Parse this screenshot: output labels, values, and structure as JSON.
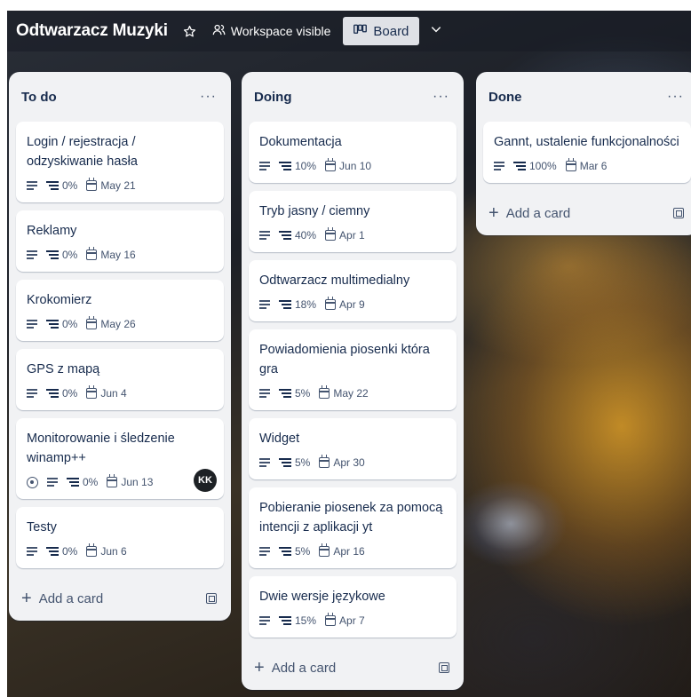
{
  "board": {
    "title": "Odtwarzacz Muzyki",
    "visibility_label": "Workspace visible",
    "view_label": "Board"
  },
  "lists": [
    {
      "title": "To do",
      "menu": "···",
      "add_label": "Add a card",
      "cards": [
        {
          "title": "Login / rejestracja / odzyskiwanie hasła",
          "progress": "0%",
          "date": "May 21"
        },
        {
          "title": "Reklamy",
          "progress": "0%",
          "date": "May 16"
        },
        {
          "title": "Krokomierz",
          "progress": "0%",
          "date": "May 26"
        },
        {
          "title": "GPS z mapą",
          "progress": "0%",
          "date": "Jun 4"
        },
        {
          "title": "Monitorowanie i śledzenie winamp++",
          "progress": "0%",
          "date": "Jun 13",
          "watched": true,
          "member": "KK"
        },
        {
          "title": "Testy",
          "progress": "0%",
          "date": "Jun 6"
        }
      ]
    },
    {
      "title": "Doing",
      "menu": "···",
      "add_label": "Add a card",
      "cards": [
        {
          "title": "Dokumentacja",
          "progress": "10%",
          "date": "Jun 10"
        },
        {
          "title": "Tryb jasny / ciemny",
          "progress": "40%",
          "date": "Apr 1"
        },
        {
          "title": "Odtwarzacz multimedialny",
          "progress": "18%",
          "date": "Apr 9"
        },
        {
          "title": "Powiadomienia piosenki która gra",
          "progress": "5%",
          "date": "May 22"
        },
        {
          "title": "Widget",
          "progress": "5%",
          "date": "Apr 30"
        },
        {
          "title": "Pobieranie piosenek za pomocą intencji z aplikacji yt",
          "progress": "5%",
          "date": "Apr 16"
        },
        {
          "title": "Dwie wersje językowe",
          "progress": "15%",
          "date": "Apr 7"
        }
      ]
    },
    {
      "title": "Done",
      "menu": "···",
      "add_label": "Add a card",
      "cards": [
        {
          "title": "Gannt, ustalenie funkcjonalności",
          "progress": "100%",
          "date": "Mar 6"
        }
      ]
    }
  ],
  "icons": {
    "star": "star-icon",
    "visibility": "workspace-icon",
    "board": "board-icon",
    "chevron": "chevron-down-icon"
  },
  "colors": {
    "list_bg": "#f1f2f4",
    "card_bg": "#ffffff",
    "text": "#172b4d",
    "avatar_bg": "#1d2125"
  }
}
